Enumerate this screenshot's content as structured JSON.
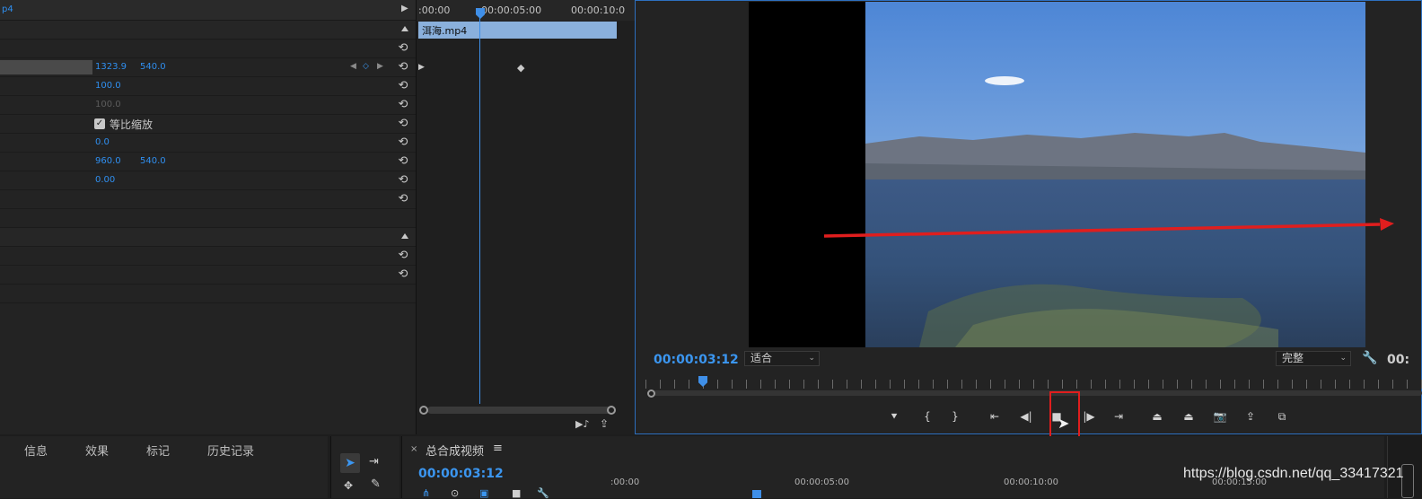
{
  "effect_controls": {
    "source_tab": "p4",
    "rows": [
      {
        "v1": "",
        "v2": ""
      },
      {
        "v1": "1323.9",
        "v2": "540.0"
      },
      {
        "v1": "100.0",
        "v2": ""
      },
      {
        "v1": "100.0",
        "v2": ""
      },
      {
        "checkbox_label": "等比缩放"
      },
      {
        "v1": "0.0",
        "v2": ""
      },
      {
        "v1": "960.0",
        "v2": "540.0"
      },
      {
        "v1": "0.00",
        "v2": ""
      }
    ]
  },
  "mini_timeline": {
    "ruler": [
      ":00:00",
      "00:00:05:00",
      "00:00:10:0"
    ],
    "clip_name": "洱海.mp4"
  },
  "program_monitor": {
    "timecode": "00:00:03:12",
    "fit_label": "适合",
    "quality_label": "完整",
    "end_timecode": "00:"
  },
  "bottom_tabs": [
    "信息",
    "效果",
    "标记",
    "历史记录"
  ],
  "sequence": {
    "title": "总合成视频",
    "timecode": "00:00:03:12",
    "ruler": [
      ":00:00",
      "00:00:05:00",
      "00:00:10:00",
      "00:00:15:00"
    ]
  },
  "watermark": "https://blog.csdn.net/qq_33417321",
  "colors": {
    "accent": "#3b96f0",
    "annotation": "#e01e1e",
    "clip": "#8ab0dc"
  }
}
